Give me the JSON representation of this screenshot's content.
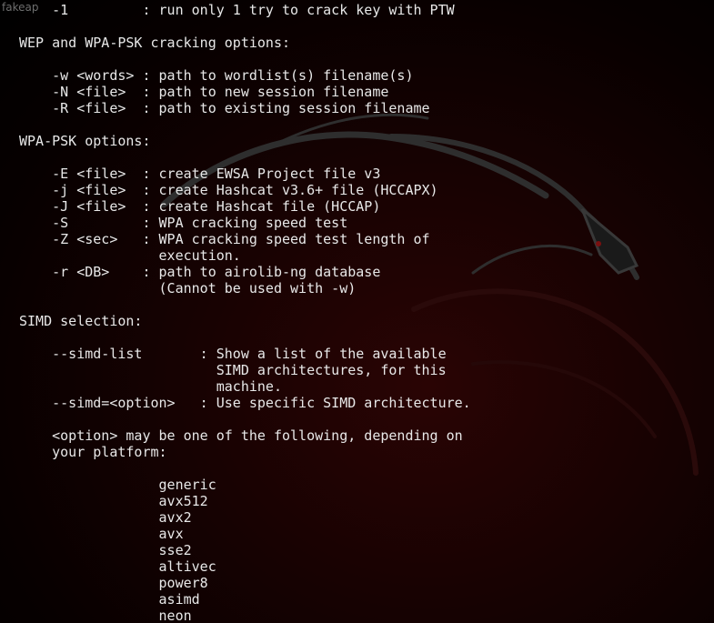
{
  "overlay_label": "fakeap",
  "terminal_lines": [
    "    -1         : run only 1 try to crack key with PTW",
    "",
    "WEP and WPA-PSK cracking options:",
    "",
    "    -w <words> : path to wordlist(s) filename(s)",
    "    -N <file>  : path to new session filename",
    "    -R <file>  : path to existing session filename",
    "",
    "WPA-PSK options:",
    "",
    "    -E <file>  : create EWSA Project file v3",
    "    -j <file>  : create Hashcat v3.6+ file (HCCAPX)",
    "    -J <file>  : create Hashcat file (HCCAP)",
    "    -S         : WPA cracking speed test",
    "    -Z <sec>   : WPA cracking speed test length of",
    "                 execution.",
    "    -r <DB>    : path to airolib-ng database",
    "                 (Cannot be used with -w)",
    "",
    "SIMD selection:",
    "",
    "    --simd-list       : Show a list of the available",
    "                        SIMD architectures, for this",
    "                        machine.",
    "    --simd=<option>   : Use specific SIMD architecture.",
    "",
    "    <option> may be one of the following, depending on",
    "    your platform:",
    "",
    "                 generic",
    "                 avx512",
    "                 avx2",
    "                 avx",
    "                 sse2",
    "                 altivec",
    "                 power8",
    "                 asimd",
    "                 neon"
  ],
  "colors": {
    "text": "#e8e8e8",
    "background": "#000000",
    "wallpaper_tint": "#2a0404",
    "logo": "#3a3a3a"
  },
  "icons": {
    "wallpaper": "kali-dragon-logo"
  }
}
